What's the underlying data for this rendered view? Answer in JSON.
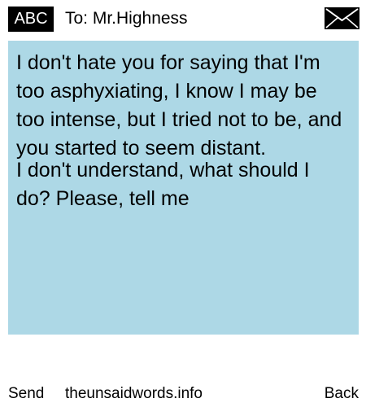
{
  "header": {
    "input_mode": "ABC",
    "recipient": "To: Mr.Highness",
    "icon": "envelope-icon"
  },
  "message": {
    "line_block_1": "I don't hate you for saying that I'm too asphyxiating, I know I may be too intense, but I tried not to be, and you started to seem distant.",
    "line_block_2": "I don't understand, what should I do? Please, tell me",
    "background_color": "#add8e6"
  },
  "footer": {
    "left_softkey": "Send",
    "site": "theunsaidwords.info",
    "right_softkey": "Back"
  }
}
